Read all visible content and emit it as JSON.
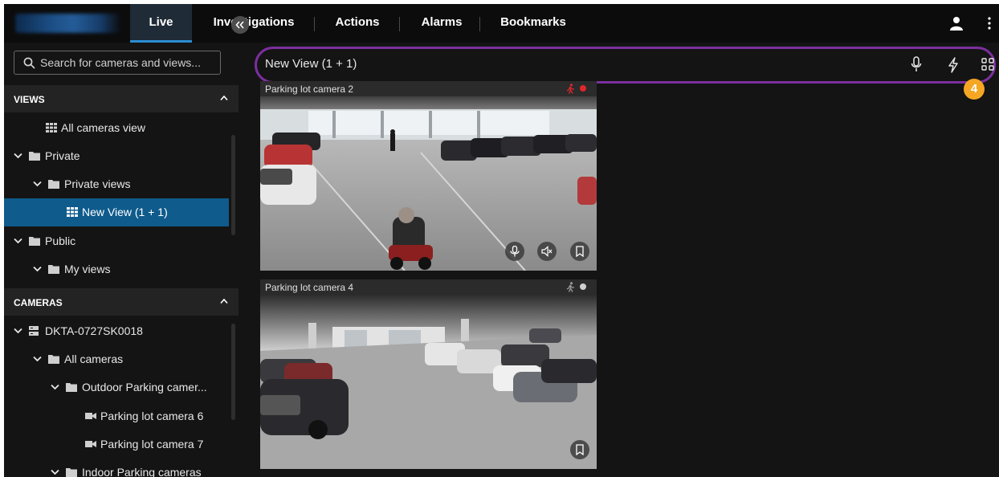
{
  "nav": {
    "tabs": [
      {
        "label": "Live",
        "active": true
      },
      {
        "label": "Investigations",
        "active": false
      },
      {
        "label": "Actions",
        "active": false
      },
      {
        "label": "Alarms",
        "active": false
      },
      {
        "label": "Bookmarks",
        "active": false
      }
    ],
    "user_icon": "user-icon",
    "more_icon": "kebab-menu-icon"
  },
  "sidebar": {
    "search_placeholder": "Search for cameras and views...",
    "views_header": "VIEWS",
    "views": [
      {
        "label": "All cameras view",
        "icon": "grid-view-icon",
        "indent": 2
      },
      {
        "label": "Private",
        "icon": "folder-icon",
        "indent": 0,
        "expanded": true
      },
      {
        "label": "Private views",
        "icon": "folder-icon",
        "indent": 1,
        "expanded": true
      },
      {
        "label": "New View (1 + 1)",
        "icon": "grid-view-icon",
        "indent": 2,
        "selected": true
      },
      {
        "label": "Public",
        "icon": "folder-icon",
        "indent": 0,
        "expanded": true
      },
      {
        "label": "My views",
        "icon": "folder-icon",
        "indent": 1,
        "expanded": true
      }
    ],
    "cameras_header": "CAMERAS",
    "cameras": [
      {
        "label": "DKTA-0727SK0018",
        "icon": "server-icon",
        "indent": 0,
        "expanded": true
      },
      {
        "label": "All cameras",
        "icon": "folder-icon",
        "indent": 1,
        "expanded": true
      },
      {
        "label": "Outdoor Parking camer...",
        "icon": "folder-icon",
        "indent": 2,
        "expanded": true
      },
      {
        "label": "Parking lot camera 6",
        "icon": "camera-icon",
        "indent": 3
      },
      {
        "label": "Parking lot camera 7",
        "icon": "camera-icon",
        "indent": 3
      },
      {
        "label": "Indoor Parking cameras",
        "icon": "folder-icon",
        "indent": 2,
        "expanded": true
      }
    ]
  },
  "view": {
    "title": "New View (1 + 1)",
    "callout_number": "4",
    "colors": {
      "highlight": "#7b2f9e",
      "callout": "#f5a623",
      "selected": "#0f5b8c",
      "tab_underline": "#2a8ed4"
    }
  },
  "tiles": [
    {
      "name": "Parking lot camera 2",
      "recording": true,
      "status_color": "#e0262b",
      "controls": [
        "microphone-icon",
        "speaker-muted-icon",
        "bookmark-icon"
      ]
    },
    {
      "name": "Parking lot camera 4",
      "recording": false,
      "status_color": "#9a9a9a",
      "controls": [
        "bookmark-icon"
      ]
    }
  ]
}
